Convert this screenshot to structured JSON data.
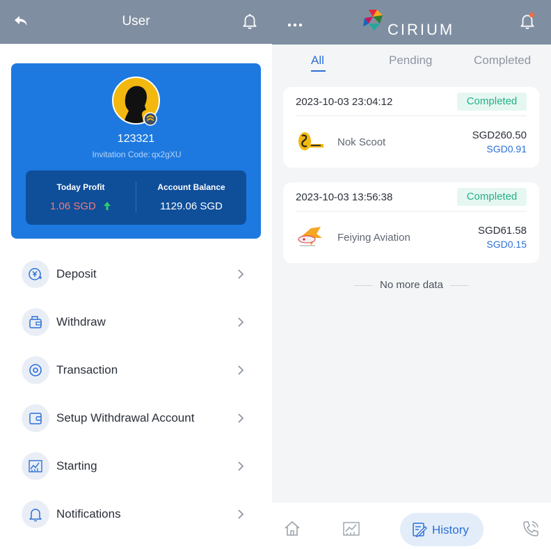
{
  "user_screen": {
    "header": {
      "title": "User",
      "back_icon": "back-arrow-icon",
      "bell_icon": "bell-icon"
    },
    "profile": {
      "username": "123321",
      "invitation_label": "Invitation Code:",
      "invitation_code": "qx2gXU",
      "today_profit_label": "Today Profit",
      "today_profit_value": "1.06 SGD",
      "account_balance_label": "Account Balance",
      "account_balance_value": "1129.06 SGD"
    },
    "menu": [
      {
        "label": "Deposit",
        "icon": "deposit-icon"
      },
      {
        "label": "Withdraw",
        "icon": "wallet-icon"
      },
      {
        "label": "Transaction",
        "icon": "target-icon"
      },
      {
        "label": "Setup Withdrawal Account",
        "icon": "card-wallet-icon"
      },
      {
        "label": "Starting",
        "icon": "chart-icon"
      },
      {
        "label": "Notifications",
        "icon": "bell-icon"
      }
    ]
  },
  "history_screen": {
    "header": {
      "logo_text": "CIRIUM",
      "menu_icon": "more-dots-icon",
      "bell_icon": "bell-icon"
    },
    "tabs": [
      {
        "label": "All",
        "active": true
      },
      {
        "label": "Pending",
        "active": false
      },
      {
        "label": "Completed",
        "active": false
      }
    ],
    "orders": [
      {
        "time": "2023-10-03 23:04:12",
        "status": "Completed",
        "name": "Nok Scoot",
        "amount": "SGD260.50",
        "profit": "SGD0.91"
      },
      {
        "time": "2023-10-03 13:56:38",
        "status": "Completed",
        "name": "Feiying Aviation",
        "amount": "SGD61.58",
        "profit": "SGD0.15"
      }
    ],
    "no_more": "No more data",
    "bottom_nav": {
      "active_label": "History",
      "items": [
        "home-icon",
        "chart-icon",
        "history-icon",
        "phone-icon"
      ]
    }
  },
  "colors": {
    "header_bg": "#7f8ea1",
    "card_blue": "#1d79e0",
    "stats_dark": "#0f4e99",
    "accent": "#2b6fd6",
    "success": "#21b186",
    "profit_red": "#f07b7b"
  }
}
